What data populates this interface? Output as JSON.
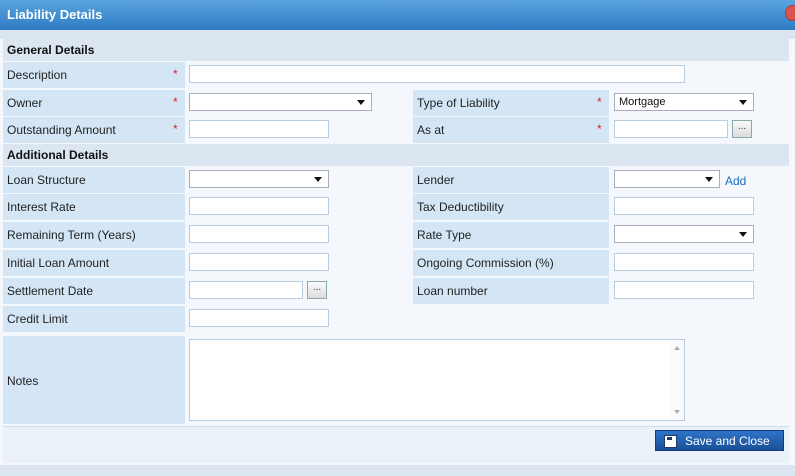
{
  "dialog": {
    "title": "Liability Details"
  },
  "sections": {
    "general": "General Details",
    "additional": "Additional Details"
  },
  "required_mark": "*",
  "fields": {
    "description": "Description",
    "owner": "Owner",
    "type_of_liability": "Type of Liability",
    "type_of_liability_value": "Mortgage",
    "outstanding_amount": "Outstanding Amount",
    "as_at": "As at",
    "loan_structure": "Loan Structure",
    "lender": "Lender",
    "add_link": "Add",
    "interest_rate": "Interest Rate",
    "tax_deductibility": "Tax Deductibility",
    "remaining_term": "Remaining Term (Years)",
    "rate_type": "Rate Type",
    "initial_loan_amount": "Initial Loan Amount",
    "ongoing_commission": "Ongoing Commission (%)",
    "settlement_date": "Settlement Date",
    "loan_number": "Loan number",
    "credit_limit": "Credit Limit",
    "notes": "Notes"
  },
  "buttons": {
    "ellipsis": "...",
    "save_and_close": "Save and Close"
  }
}
